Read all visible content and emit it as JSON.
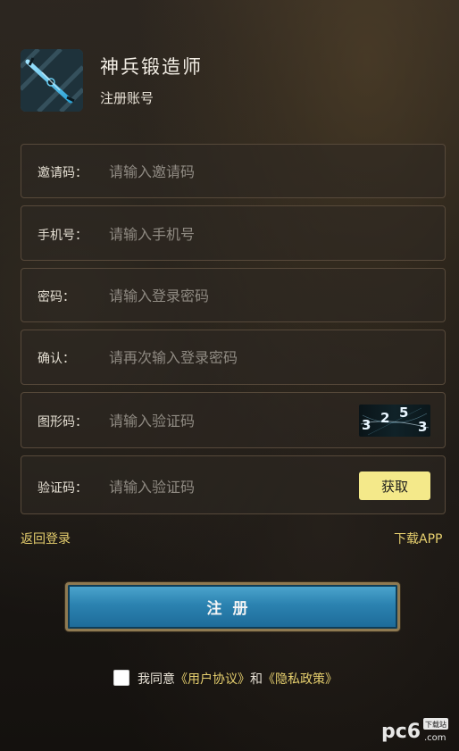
{
  "header": {
    "app_name": "神兵锻造师",
    "subtitle": "注册账号"
  },
  "form": {
    "invite": {
      "label": "邀请码：",
      "placeholder": "请输入邀请码"
    },
    "phone": {
      "label": "手机号：",
      "placeholder": "请输入手机号"
    },
    "password": {
      "label": "密码：",
      "placeholder": "请输入登录密码"
    },
    "confirm": {
      "label": "确认：",
      "placeholder": "请再次输入登录密码"
    },
    "captcha": {
      "label": "图形码：",
      "placeholder": "请输入验证码",
      "image_text": "3253"
    },
    "sms": {
      "label": "验证码：",
      "placeholder": "请输入验证码",
      "button_label": "获取"
    }
  },
  "links": {
    "back_login": "返回登录",
    "download_app": "下载APP"
  },
  "register_button": "注册",
  "agreement": {
    "prefix": "我同意",
    "user_agreement": "《用户协议》",
    "and": "和",
    "privacy_policy": "《隐私政策》",
    "checked": false
  },
  "watermark": {
    "logo_text": "pc6",
    "domain": ".com",
    "badge": "下载站"
  },
  "colors": {
    "accent_yellow": "#e6cf6e",
    "button_blue": "#2b82b0",
    "get_button": "#f4e98a"
  }
}
